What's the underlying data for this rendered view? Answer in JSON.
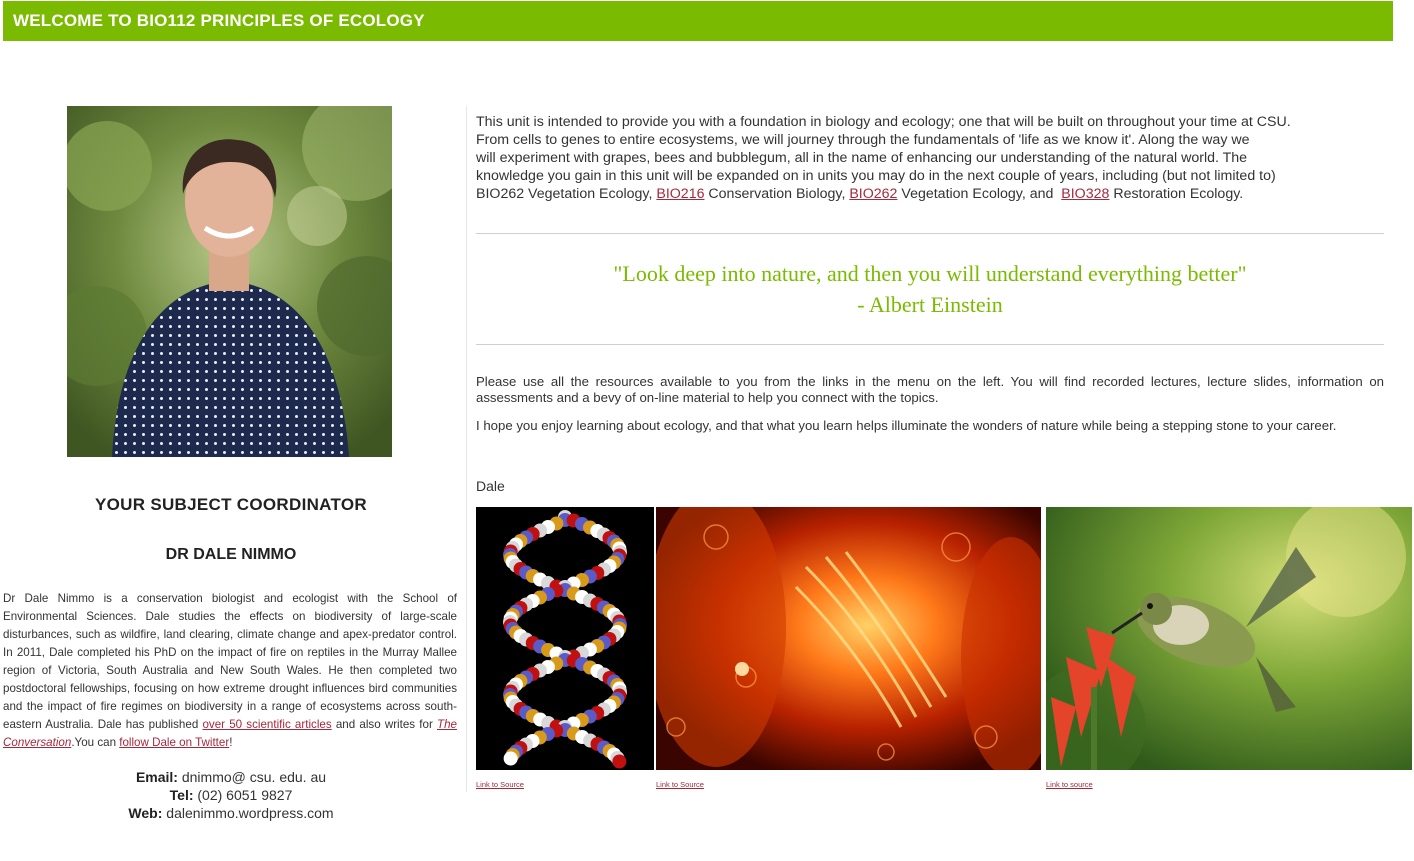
{
  "header": {
    "title": "WELCOME TO BIO112 PRINCIPLES OF ECOLOGY"
  },
  "colors": {
    "accent": "#7aba00",
    "link": "#a5283c"
  },
  "coordinator": {
    "heading": "YOUR SUBJECT COORDINATOR",
    "name": "DR DALE NIMMO",
    "portrait_icon": "person-photo",
    "bio_part1": "Dr Dale Nimmo is a conservation biologist and ecologist with the School of Environmental Sciences. Dale studies the effects on biodiversity of large-scale disturbances, such as wildfire, land clearing, climate change and apex-predator control. In 2011, Dale completed his PhD on the impact of fire on reptiles in the Murray Mallee region of Victoria, South Australia and New South Wales. He then completed two postdoctoral fellowships, focusing on how extreme drought influences bird communities and the impact of fire regimes on biodiversity in a range of ecosystems across south-eastern Australia. Dale has published ",
    "bio_link1": "over 50 scientific articles",
    "bio_part2": " and also writes for ",
    "bio_link2": "The Conversation",
    "bio_part3": ".You can ",
    "bio_link3": "follow Dale on Twitter",
    "bio_part4": "!",
    "email_label": "Email:",
    "email": " dnimmo@ csu. edu. au",
    "tel_label": "Tel:",
    "tel": " (02) 6051 9827",
    "web_label": "Web:",
    "web": " dalenimmo.wordpress.com"
  },
  "intro": {
    "line1": "This unit is intended to provide you with a foundation in biology and ecology; one that will be built on throughout your time at CSU.",
    "line2": "From cells to genes to entire ecosystems, we will journey through the fundamentals of 'life as we know it'. Along the way we",
    "line3": "will experiment with grapes, bees and bubblegum, all in the name of enhancing our understanding of the natural world. The",
    "line4": "knowledge you gain in this unit will be expanded on in units you may do in the next couple of years, including (but not limited to)",
    "line5_a": "BIO262 Vegetation Ecology, ",
    "link_bio216": "BIO216",
    "line5_b": " Conservation Biology, ",
    "link_bio262": "BIO262",
    "line5_c": " Vegetation Ecology, and  ",
    "link_bio328": "BIO328",
    "line5_d": " Restoration Ecology."
  },
  "quote": {
    "text": "\"Look deep into nature, and then you will understand everything better\"",
    "author": "- Albert Einstein"
  },
  "body": {
    "p1": "Please use all the resources available to you from the links in the menu on the left. You will find recorded lectures, lecture slides, information on assessments and a bevy of on-line material to help you connect with the topics.",
    "p2": "I hope you enjoy learning about ecology, and that what you learn helps illuminate the wonders of nature while being a stepping stone to your career.",
    "signoff": "Dale"
  },
  "images": [
    {
      "icon": "dna-helix-image",
      "link": "Link to Source"
    },
    {
      "icon": "cell-division-image",
      "link": "Link to Source"
    },
    {
      "icon": "hummingbird-image",
      "link": "Link to source"
    }
  ]
}
